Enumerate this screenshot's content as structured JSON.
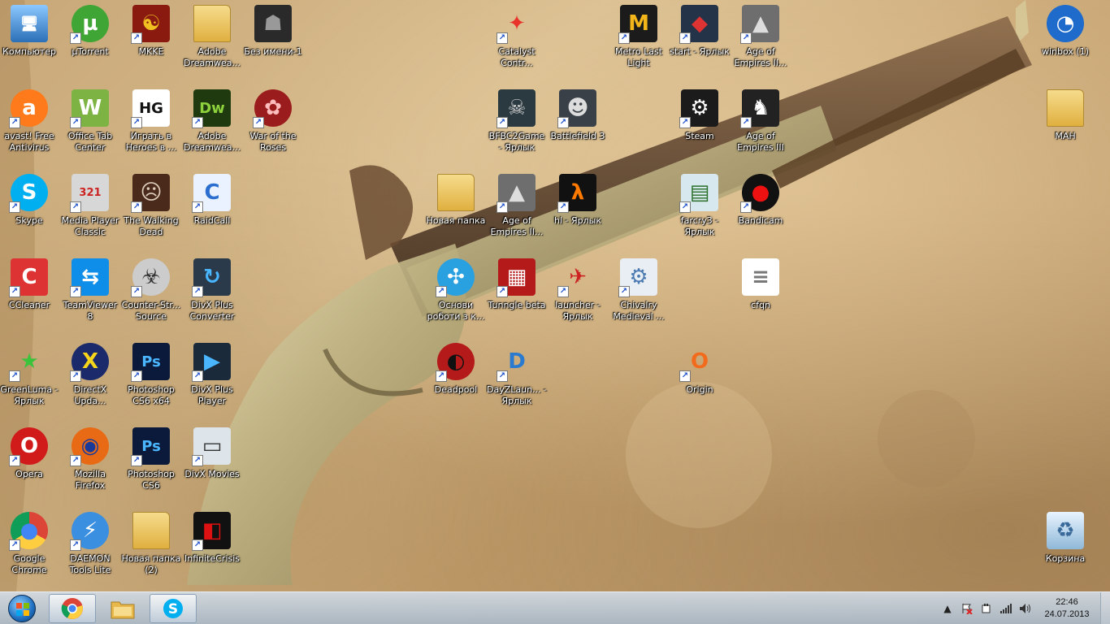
{
  "desktop": {
    "icons": [
      {
        "label": "Компьютер",
        "shortcut": false,
        "icon": "computer-icon"
      },
      {
        "label": "µTorrent",
        "shortcut": true,
        "icon": "utorrent-icon"
      },
      {
        "label": "MKKE",
        "shortcut": true,
        "icon": "mkke-icon"
      },
      {
        "label": "Adobe Dreamwea...",
        "shortcut": false,
        "icon": "folder-icon"
      },
      {
        "label": "Без имени-1",
        "shortcut": false,
        "icon": "image-file-icon"
      },
      {
        "label": "Catalyst Contr...",
        "shortcut": true,
        "icon": "catalyst-icon"
      },
      {
        "label": "Metro Last Light",
        "shortcut": true,
        "icon": "metro-icon"
      },
      {
        "label": "start - Ярлык",
        "shortcut": true,
        "icon": "start-game-icon"
      },
      {
        "label": "Age of Empires II...",
        "shortcut": true,
        "icon": "age-of-empires-icon"
      },
      {
        "label": "winbox (1)",
        "shortcut": false,
        "icon": "winbox-icon"
      },
      {
        "label": "avast! Free Antivirus",
        "shortcut": true,
        "icon": "avast-icon"
      },
      {
        "label": "Office Tab Center",
        "shortcut": true,
        "icon": "office-tab-icon"
      },
      {
        "label": "Играть в Heroes в ...",
        "shortcut": true,
        "icon": "heroes-icon"
      },
      {
        "label": "Adobe Dreamwea...",
        "shortcut": true,
        "icon": "dreamweaver-icon"
      },
      {
        "label": "War of the Roses",
        "shortcut": true,
        "icon": "war-of-roses-icon"
      },
      {
        "label": "BFBC2Game - Ярлык",
        "shortcut": true,
        "icon": "bfbc2-icon"
      },
      {
        "label": "Battlefield 3",
        "shortcut": true,
        "icon": "battlefield3-icon"
      },
      {
        "label": "Steam",
        "shortcut": true,
        "icon": "steam-icon"
      },
      {
        "label": "Age of Empires III",
        "shortcut": true,
        "icon": "age-of-empires-3-icon"
      },
      {
        "label": "MAH",
        "shortcut": false,
        "icon": "folder-icon"
      },
      {
        "label": "Skype",
        "shortcut": true,
        "icon": "skype-icon"
      },
      {
        "label": "Media Player Classic",
        "shortcut": true,
        "icon": "media-player-classic-icon"
      },
      {
        "label": "The Walking Dead",
        "shortcut": true,
        "icon": "walking-dead-icon"
      },
      {
        "label": "RaidCall",
        "shortcut": true,
        "icon": "raidcall-icon"
      },
      {
        "label": "Новая папка",
        "shortcut": false,
        "icon": "folder-icon"
      },
      {
        "label": "Age of Empires II...",
        "shortcut": true,
        "icon": "age-of-empires-icon"
      },
      {
        "label": "hl - Ярлык",
        "shortcut": true,
        "icon": "half-life-icon"
      },
      {
        "label": "farcry3 - Ярлык",
        "shortcut": true,
        "icon": "farcry3-icon"
      },
      {
        "label": "Bandicam",
        "shortcut": true,
        "icon": "bandicam-icon"
      },
      {
        "label": "CCleaner",
        "shortcut": true,
        "icon": "ccleaner-icon"
      },
      {
        "label": "TeamViewer 8",
        "shortcut": true,
        "icon": "teamviewer-icon"
      },
      {
        "label": "Counter-Str... Source",
        "shortcut": true,
        "icon": "counter-strike-icon"
      },
      {
        "label": "DivX Plus Converter",
        "shortcut": true,
        "icon": "divx-converter-icon"
      },
      {
        "label": "Основи роботи з к...",
        "shortcut": true,
        "icon": "osnovi-icon"
      },
      {
        "label": "Tunngle beta",
        "shortcut": true,
        "icon": "tunngle-icon"
      },
      {
        "label": "launcher - Ярлык",
        "shortcut": true,
        "icon": "launcher-icon"
      },
      {
        "label": "Chivalry Medieval ...",
        "shortcut": true,
        "icon": "chivalry-icon"
      },
      {
        "label": "cfqn",
        "shortcut": false,
        "icon": "text-file-icon"
      },
      {
        "label": "GreenLuma - Ярлык",
        "shortcut": true,
        "icon": "greenluma-icon"
      },
      {
        "label": "DirectX Upda...",
        "shortcut": true,
        "icon": "directx-icon"
      },
      {
        "label": "Photoshop CS6 x64",
        "shortcut": true,
        "icon": "photoshop-icon"
      },
      {
        "label": "DivX Plus Player",
        "shortcut": true,
        "icon": "divx-player-icon"
      },
      {
        "label": "Deadpool",
        "shortcut": true,
        "icon": "deadpool-icon"
      },
      {
        "label": "DayZLaun... - Ярлык",
        "shortcut": true,
        "icon": "dayz-launcher-icon"
      },
      {
        "label": "Origin",
        "shortcut": true,
        "icon": "origin-icon"
      },
      {
        "label": "Opera",
        "shortcut": true,
        "icon": "opera-icon"
      },
      {
        "label": "Mozilla Firefox",
        "shortcut": true,
        "icon": "firefox-icon"
      },
      {
        "label": "Photoshop CS6",
        "shortcut": true,
        "icon": "photoshop-icon"
      },
      {
        "label": "DivX Movies",
        "shortcut": true,
        "icon": "divx-movies-icon"
      },
      {
        "label": "Google Chrome",
        "shortcut": true,
        "icon": "chrome-icon"
      },
      {
        "label": "DAEMON Tools Lite",
        "shortcut": true,
        "icon": "daemon-tools-icon"
      },
      {
        "label": "Новая папка (2)",
        "shortcut": false,
        "icon": "folder-icon"
      },
      {
        "label": "InfiniteCrisis",
        "shortcut": true,
        "icon": "infinite-crisis-icon"
      },
      {
        "label": "Корзина",
        "shortcut": false,
        "icon": "recycle-bin-icon"
      }
    ]
  },
  "taskbar": {
    "start_icon": "windows-start-icon",
    "pinned": [
      {
        "name": "chrome",
        "icon": "chrome-icon",
        "active": true
      },
      {
        "name": "explorer",
        "icon": "folder-icon",
        "active": false
      },
      {
        "name": "skype",
        "icon": "skype-icon",
        "active": true
      }
    ],
    "tray": {
      "icons": [
        "show-hidden-icons-icon",
        "action-center-icon",
        "power-icon",
        "network-icon",
        "volume-icon"
      ],
      "time": "22:46",
      "date": "24.07.2013"
    }
  }
}
